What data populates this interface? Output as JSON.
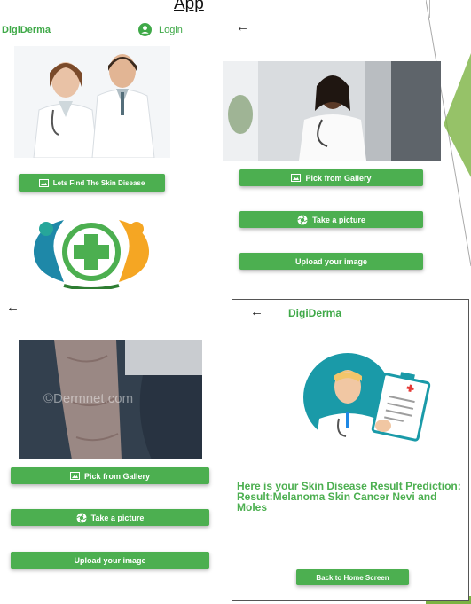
{
  "slide_title": "App",
  "screen1": {
    "brand": "DigiDerma",
    "login_label": "Login",
    "find_button": "Lets Find The Skin Disease"
  },
  "screen2": {
    "back_arrow": "←",
    "gallery_button": "Pick from Gallery",
    "camera_button": "Take a picture",
    "upload_button": "Upload your image"
  },
  "screen3": {
    "back_arrow": "←",
    "watermark": "©Dermnet.com",
    "gallery_button": "Pick from Gallery",
    "camera_button": "Take a picture",
    "upload_button": "Upload your image"
  },
  "screen4": {
    "back_arrow": "←",
    "brand": "DigiDerma",
    "result_text": "Here is your Skin Disease Result Prediction: Result:Melanoma Skin Cancer Nevi and Moles",
    "home_button": "Back to Home Screen"
  },
  "colors": {
    "accent_green": "#4caf50",
    "brand_green": "#3fa948"
  }
}
